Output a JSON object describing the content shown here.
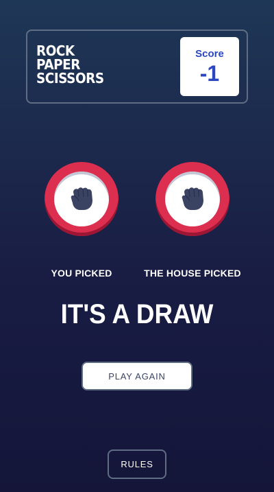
{
  "header": {
    "title_lines": [
      "ROCK",
      "PAPER",
      "SCISSORS"
    ],
    "score_label": "Score",
    "score_value": "-1"
  },
  "picks": {
    "you": {
      "label": "YOU PICKED",
      "choice": "rock",
      "icon": "rock-fist-icon"
    },
    "house": {
      "label": "THE HOUSE PICKED",
      "choice": "rock",
      "icon": "rock-fist-icon"
    }
  },
  "result": {
    "text": "IT'S A DRAW",
    "play_again_label": "PLAY AGAIN"
  },
  "footer": {
    "rules_label": "RULES"
  },
  "colors": {
    "rock_ring": "#dc2e4e",
    "score_text": "#2a46c0",
    "background_top": "#1f3756",
    "background_bottom": "#141539",
    "header_border": "#606e85"
  }
}
